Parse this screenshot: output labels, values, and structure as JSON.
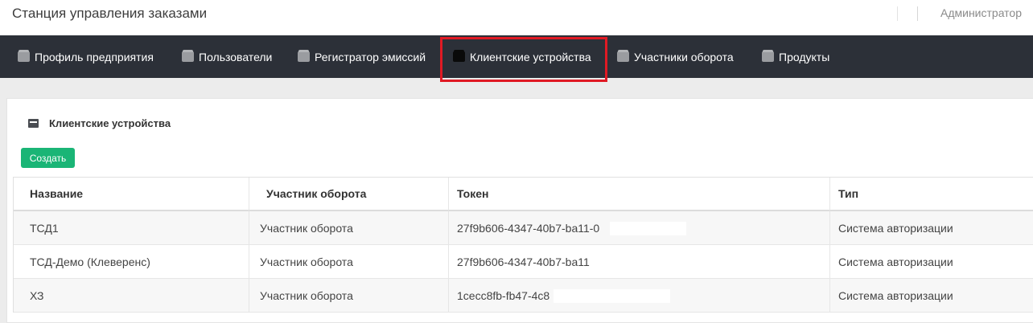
{
  "header": {
    "title": "Станция управления заказами",
    "user": "Администратор"
  },
  "nav": {
    "items": [
      {
        "label": "Профиль предприятия",
        "icon": "folder-icon"
      },
      {
        "label": "Пользователи",
        "icon": "folder-icon"
      },
      {
        "label": "Регистратор эмиссий",
        "icon": "folder-icon"
      },
      {
        "label": "Клиентские устройства",
        "icon": "folder-icon",
        "active": true
      },
      {
        "label": "Участники оборота",
        "icon": "folder-icon"
      },
      {
        "label": "Продукты",
        "icon": "folder-icon"
      }
    ],
    "highlight_color": "#e01a24"
  },
  "panel": {
    "heading": "Клиентские устройства",
    "heading_icon": "card-icon",
    "create_label": "Создать",
    "create_color": "#1ab576"
  },
  "table": {
    "columns": [
      "Название",
      "Участник оборота",
      "Токен",
      "Тип"
    ],
    "rows": [
      {
        "name": "ТСД1",
        "participant": "Участник оборота",
        "token": "27f9b606-4347-40b7-ba11-0",
        "type": "Система авторизации"
      },
      {
        "name": "ТСД-Демо (Клеверенс)",
        "participant": "Участник оборота",
        "token": "27f9b606-4347-40b7-ba11",
        "type": "Система авторизации"
      },
      {
        "name": "ХЗ",
        "participant": "Участник оборота",
        "token": "1cecc8fb-fb47-4c8",
        "type": "Система авторизации"
      }
    ]
  }
}
